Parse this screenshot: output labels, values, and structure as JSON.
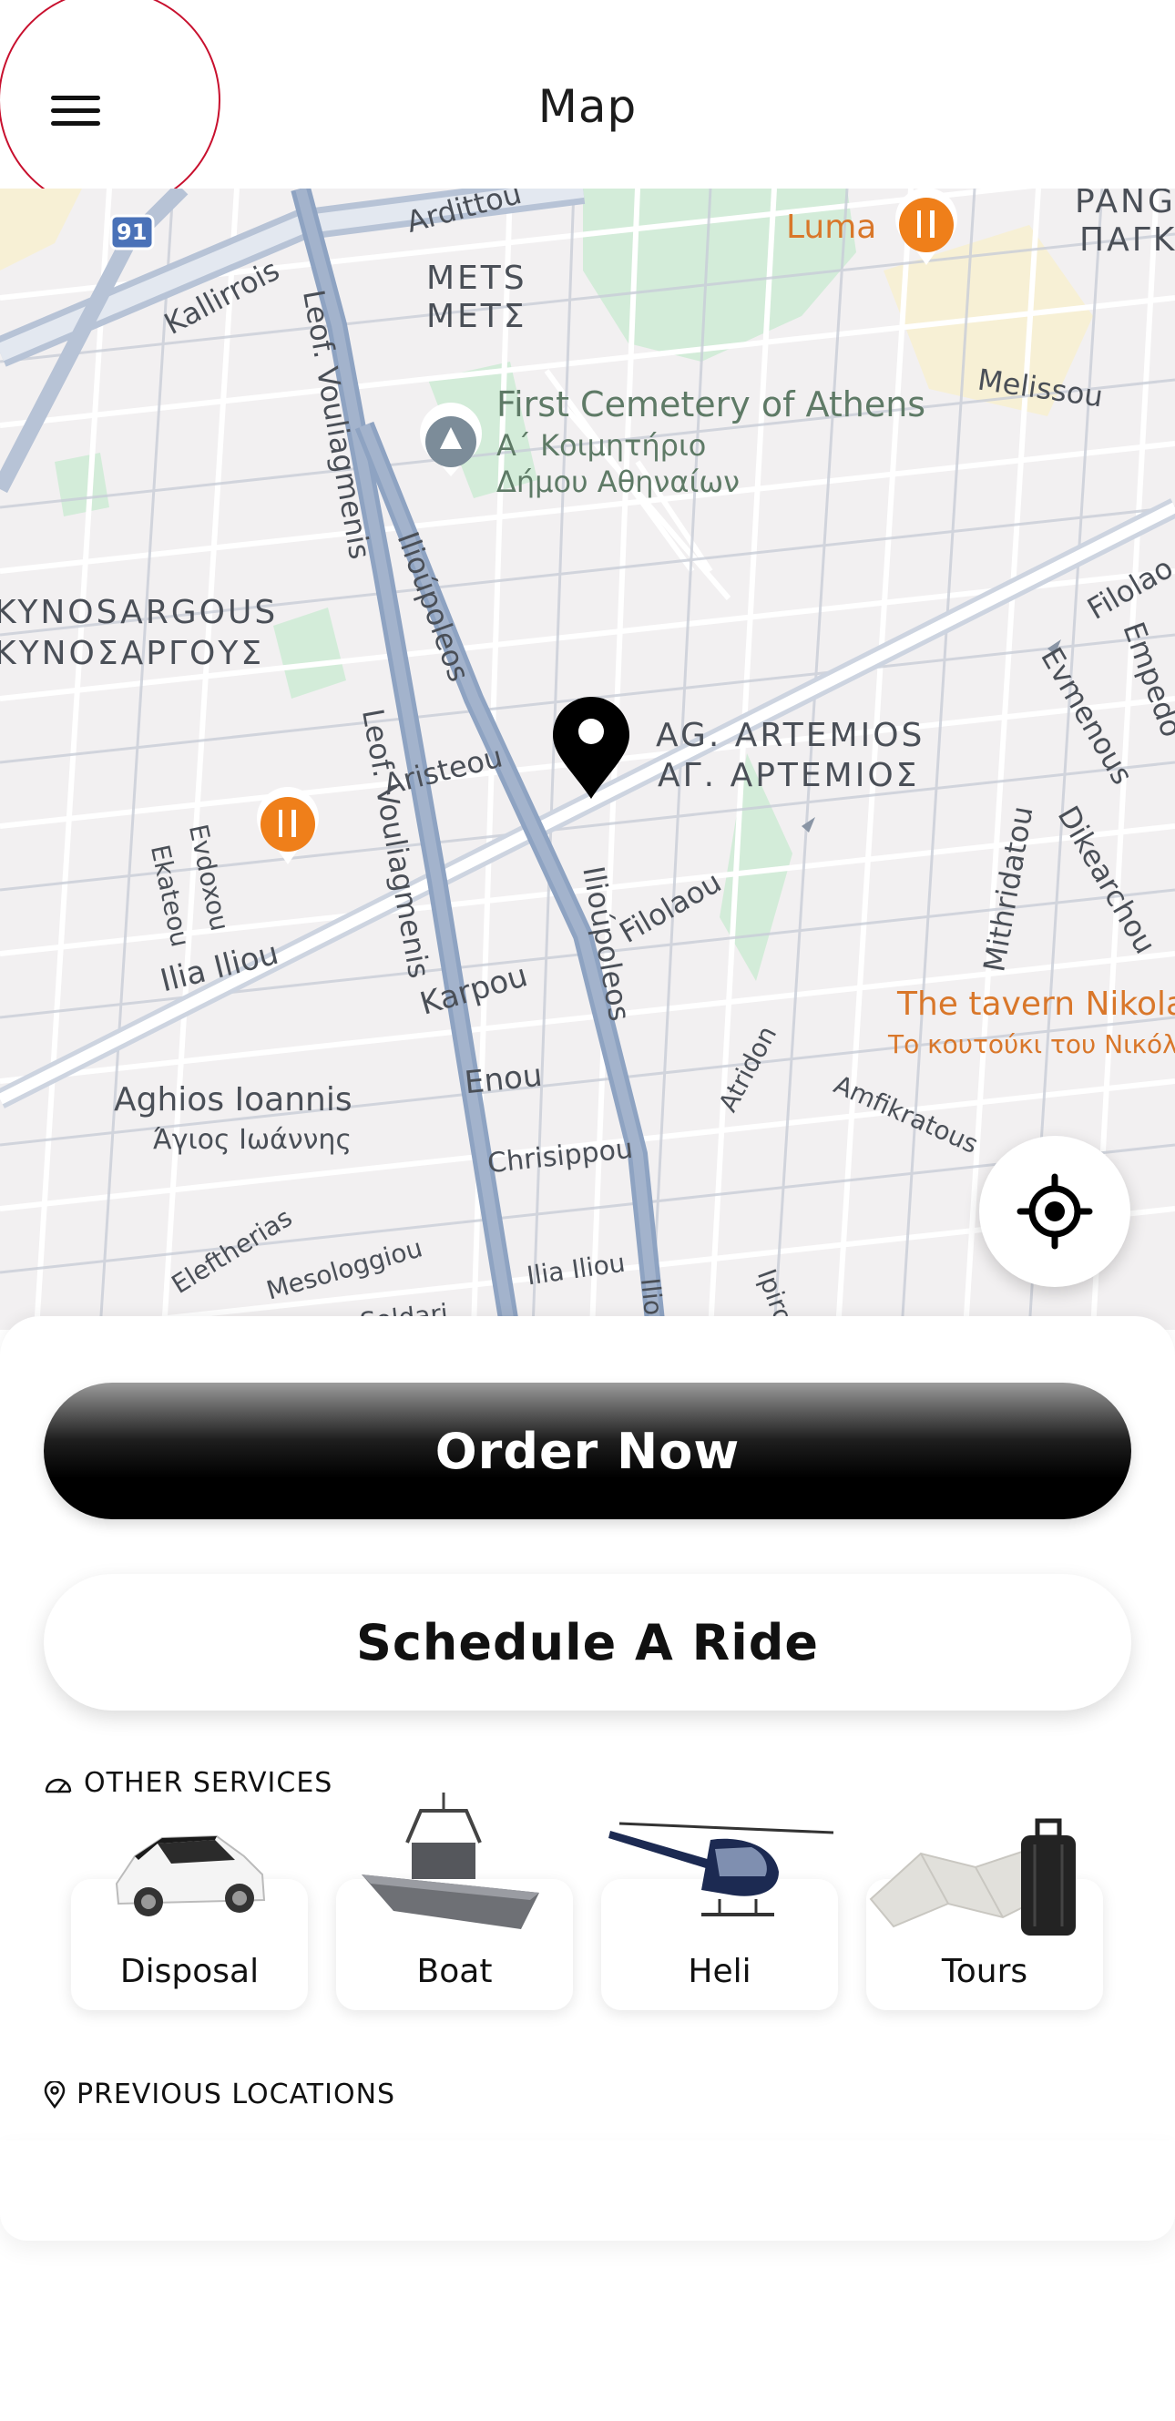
{
  "header": {
    "title": "Map",
    "menu_icon": "hamburger-menu-icon"
  },
  "map": {
    "labels": {
      "ardittou": "Ardittou",
      "kallirrois": "Kallirrois",
      "mets_en": "METS",
      "mets_gr": "ΜΕΤΣ",
      "luma": "Luma",
      "pangrati_en": "PANG",
      "pangrati_gr": "ΠΑΓΚ",
      "melissou": "Melissou",
      "cemetery_en": "First Cemetery of Athens",
      "cemetery_gr1": "Α΄ Κοιμητήριο",
      "cemetery_gr2": "Δήμου Αθηναίων",
      "leof_vouliagmenis_1": "Leof. Vouliagmenis",
      "leof_vouliagmenis_2": "Leof. Vouliagmenis",
      "iliou_1": "Ilioúpoleos",
      "iliou_2": "Ilioúpoleos",
      "kynosargous_en": "KYNOSARGOUS",
      "kynosargous_gr": "ΚΥΝΟΣΑΡΓΟΥΣ",
      "ag_artemios_en": "AG. ARTEMIOS",
      "ag_artemios_gr": "ΑΓ. ΑΡΤΕΜΙΟΣ",
      "filolaou_1": "Filolao",
      "filolaou_2": "Filolaou",
      "empedo": "Empedo",
      "evmenous": "Evmenous",
      "dikearchou": "Dikearchou",
      "mithridatou": "Mithridatou",
      "aristeou": "Aristeou",
      "evdoxou": "Evdoxou",
      "ekateou": "Ekateou",
      "ilia_iliou": "Ilia Iliou",
      "karpou": "Karpou",
      "enou": "Enou",
      "chrisippou": "Chrisippou",
      "aghios_ioannis_en": "Aghios Ioannis",
      "aghios_ioannis_gr": "Άγιος Ιωάννης",
      "atridon": "Atridon",
      "amfikratous": "Amfikratous",
      "tavern_en": "The tavern Nikola",
      "tavern_gr": "Το κουτούκι του Νικόλ",
      "eleftherias": "Eleftherias",
      "mesologgiou": "Mesologgiou",
      "ilia_iliou_2": "Ilia Iliou",
      "sldari": "Soldari",
      "ilio_3": "Ilio",
      "ipiro": "Ipiro",
      "route_91": "91"
    },
    "colors": {
      "background": "#f2f0f1",
      "road": "#ffffff",
      "major_road": "#a3b3cc",
      "park": "#cfe9d6",
      "poi_food": "#ef7f1a"
    }
  },
  "actions": {
    "order_now": "Order Now",
    "schedule_ride": "Schedule A Ride"
  },
  "other_services": {
    "title": "OTHER SERVICES",
    "icon": "speedometer-icon",
    "items": [
      {
        "label": "Disposal",
        "icon": "suv-car-icon"
      },
      {
        "label": "Boat",
        "icon": "speedboat-icon"
      },
      {
        "label": "Heli",
        "icon": "helicopter-icon"
      },
      {
        "label": "Tours",
        "icon": "map-luggage-icon"
      }
    ]
  },
  "previous_locations": {
    "title": "PREVIOUS LOCATIONS",
    "icon": "location-pin-icon"
  }
}
